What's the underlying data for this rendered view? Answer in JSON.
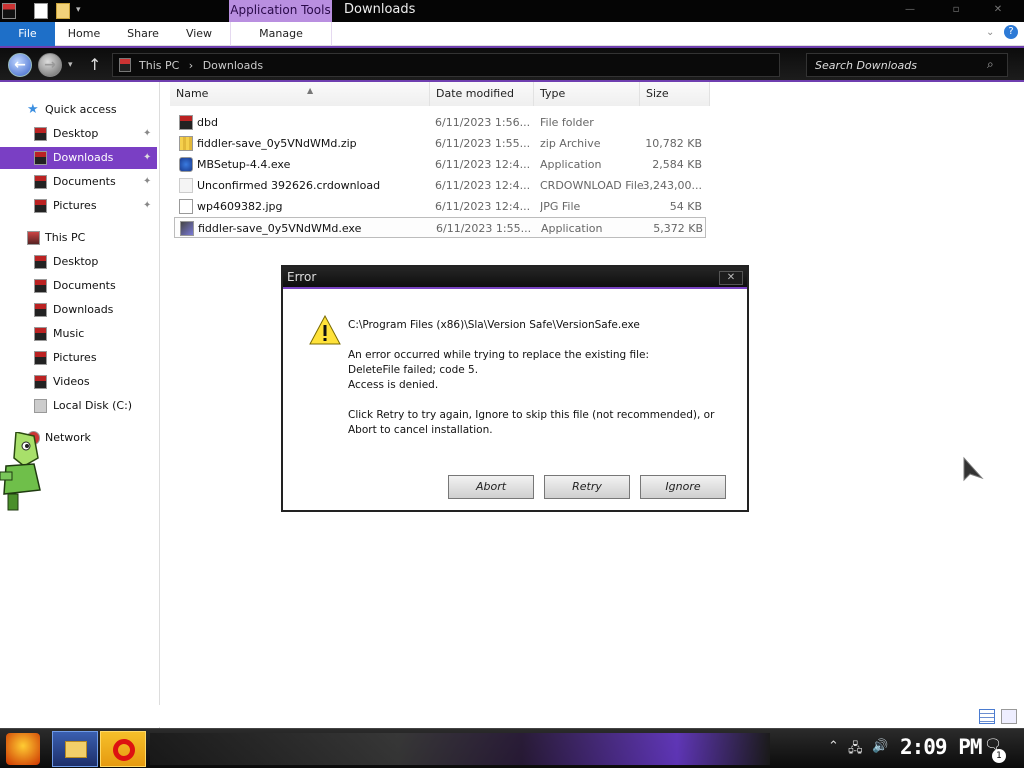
{
  "titlebar": {
    "context_tab": "Application Tools",
    "title": "Downloads",
    "buttons": [
      "—",
      "▫",
      "✕"
    ]
  },
  "ribbon": {
    "tabs": [
      "File",
      "Home",
      "Share",
      "View",
      "Manage"
    ]
  },
  "address": {
    "crumbs": [
      "This PC",
      "›",
      "Downloads"
    ],
    "separator": "›",
    "search_placeholder": "Search Downloads"
  },
  "sidebar": {
    "items": [
      {
        "label": "Quick access"
      },
      {
        "label": "Desktop",
        "pinned": true
      },
      {
        "label": "Downloads",
        "pinned": true,
        "active": true
      },
      {
        "label": "Documents",
        "pinned": true
      },
      {
        "label": "Pictures",
        "pinned": true
      },
      {
        "label": "This PC"
      },
      {
        "label": "Desktop"
      },
      {
        "label": "Documents"
      },
      {
        "label": "Downloads"
      },
      {
        "label": "Music"
      },
      {
        "label": "Pictures"
      },
      {
        "label": "Videos"
      },
      {
        "label": "Local Disk (C:)"
      },
      {
        "label": "Network"
      }
    ]
  },
  "columns": [
    "Name",
    "Date modified",
    "Type",
    "Size"
  ],
  "files": [
    {
      "name": "dbd",
      "date": "6/11/2023 1:56...",
      "type": "File folder",
      "size": "",
      "icon": "folder-icon"
    },
    {
      "name": "fiddler-save_0y5VNdWMd.zip",
      "date": "6/11/2023 1:55...",
      "type": "zip Archive",
      "size": "10,782 KB",
      "icon": "zip-file-icon"
    },
    {
      "name": "MBSetup-4.4.exe",
      "date": "6/11/2023 12:4...",
      "type": "Application",
      "size": "2,584 KB",
      "icon": "malwarebytes-icon"
    },
    {
      "name": "Unconfirmed 392626.crdownload",
      "date": "6/11/2023 12:4...",
      "type": "CRDOWNLOAD File",
      "size": "3,243,00...",
      "icon": "partial-download-icon"
    },
    {
      "name": "wp4609382.jpg",
      "date": "6/11/2023 12:4...",
      "type": "JPG File",
      "size": "54 KB",
      "icon": "image-file-icon"
    },
    {
      "name": "fiddler-save_0y5VNdWMd.exe",
      "date": "6/11/2023 1:55...",
      "type": "Application",
      "size": "5,372 KB",
      "icon": "application-icon",
      "selected": true
    }
  ],
  "dialog": {
    "title": "Error",
    "close": "✕",
    "path": "C:\\Program Files (x86)\\Sla\\Version Safe\\VersionSafe.exe",
    "line1": "An error occurred while trying to replace the existing file:",
    "line2": "DeleteFile failed; code 5.",
    "line3": "Access is denied.",
    "line4": "Click Retry to try again, Ignore to skip this file (not recommended), or",
    "line5": "Abort to cancel installation.",
    "buttons": [
      "Abort",
      "Retry",
      "Ignore"
    ]
  },
  "taskbar": {
    "clock": "2:09 PM",
    "notification_count": "1"
  },
  "icons": {
    "back": "←",
    "forward": "→",
    "up": "↑",
    "search": "⌕",
    "pin": "✦",
    "sort": "▲",
    "expand": "⌄",
    "help": "?"
  },
  "colors": {
    "accent": "#7a3fc4",
    "file_tab": "#1e6fc8",
    "context_tab": "#b98fe0"
  }
}
